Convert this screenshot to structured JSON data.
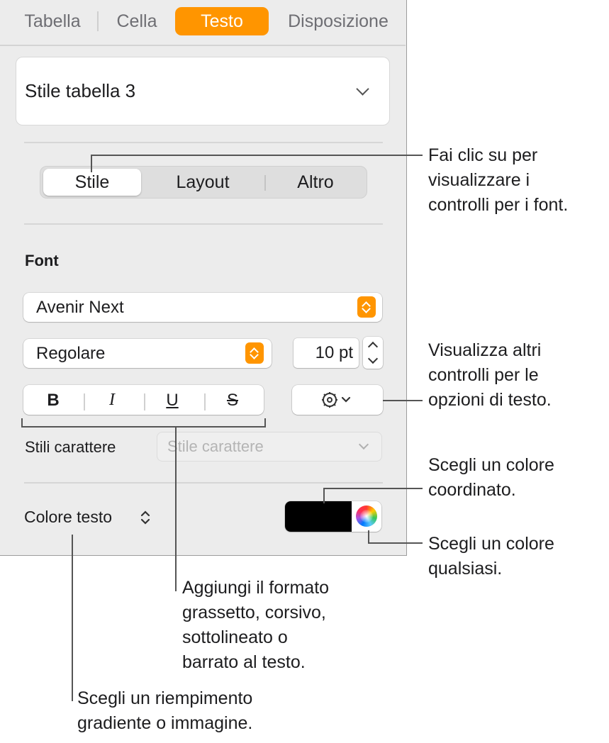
{
  "tabs": {
    "tabella": "Tabella",
    "cella": "Cella",
    "testo": "Testo",
    "disposizione": "Disposizione"
  },
  "table_style": {
    "label": "Stile tabella 3"
  },
  "segment": {
    "stile": "Stile",
    "layout": "Layout",
    "altro": "Altro"
  },
  "font": {
    "section_title": "Font",
    "family": "Avenir Next",
    "typeface": "Regolare",
    "size": "10 pt",
    "bold": "B",
    "italic": "I",
    "underline": "U",
    "strike": "S"
  },
  "char_styles": {
    "label": "Stili carattere",
    "placeholder": "Stile carattere"
  },
  "text_color": {
    "label": "Colore testo",
    "swatch_color": "#000000"
  },
  "callouts": {
    "segment": [
      "Fai clic su per",
      "visualizzare i",
      "controlli per i font."
    ],
    "advanced": [
      "Visualizza altri",
      "controlli per le",
      "opzioni di testo."
    ],
    "well": [
      "Scegli un colore",
      "coordinato."
    ],
    "wheel": [
      "Scegli un colore",
      "qualsiasi."
    ],
    "format": [
      "Aggiungi il formato",
      "grassetto, corsivo,",
      "sottolineato o",
      "barrato al testo."
    ],
    "fill": [
      "Scegli un riempimento",
      "gradiente o immagine."
    ]
  },
  "colors": {
    "accent": "#ff9500",
    "panel_bg": "#ececec"
  }
}
